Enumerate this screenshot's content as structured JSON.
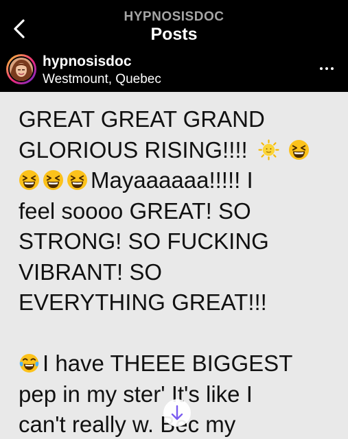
{
  "header": {
    "account_title": "HYPNOSISDOC",
    "page_title": "Posts"
  },
  "post": {
    "username": "hypnosisdoc",
    "location": "Westmount, Quebec",
    "caption": {
      "line1": "GREAT GREAT GRAND",
      "line2": "GLORIOUS RISING!!!!",
      "line3": "Mayaaaaaa!!!!! I",
      "line4": "feel soooo GREAT! SO",
      "line5": "STRONG! SO FUCKING",
      "line6": "VIBRANT!  SO",
      "line7": "EVERYTHING GREAT!!!",
      "line8": "I have THEEE BIGGEST",
      "line9": "pep in my ster'  It's like I",
      "line10": "can't really w.    Bec my"
    }
  },
  "colors": {
    "background": "#000000",
    "caption_background": "#e9e9e9",
    "caption_text": "#111111",
    "muted_title": "#a6a6a6",
    "accent_arrow": "#7b5cf0"
  },
  "icons": {
    "back": "chevron-left-icon",
    "more": "more-horizontal-icon",
    "scroll": "arrow-down-icon",
    "emojis": [
      "sun-emoji-icon",
      "grinning-squint-emoji-icon",
      "tears-of-joy-emoji-icon"
    ]
  }
}
